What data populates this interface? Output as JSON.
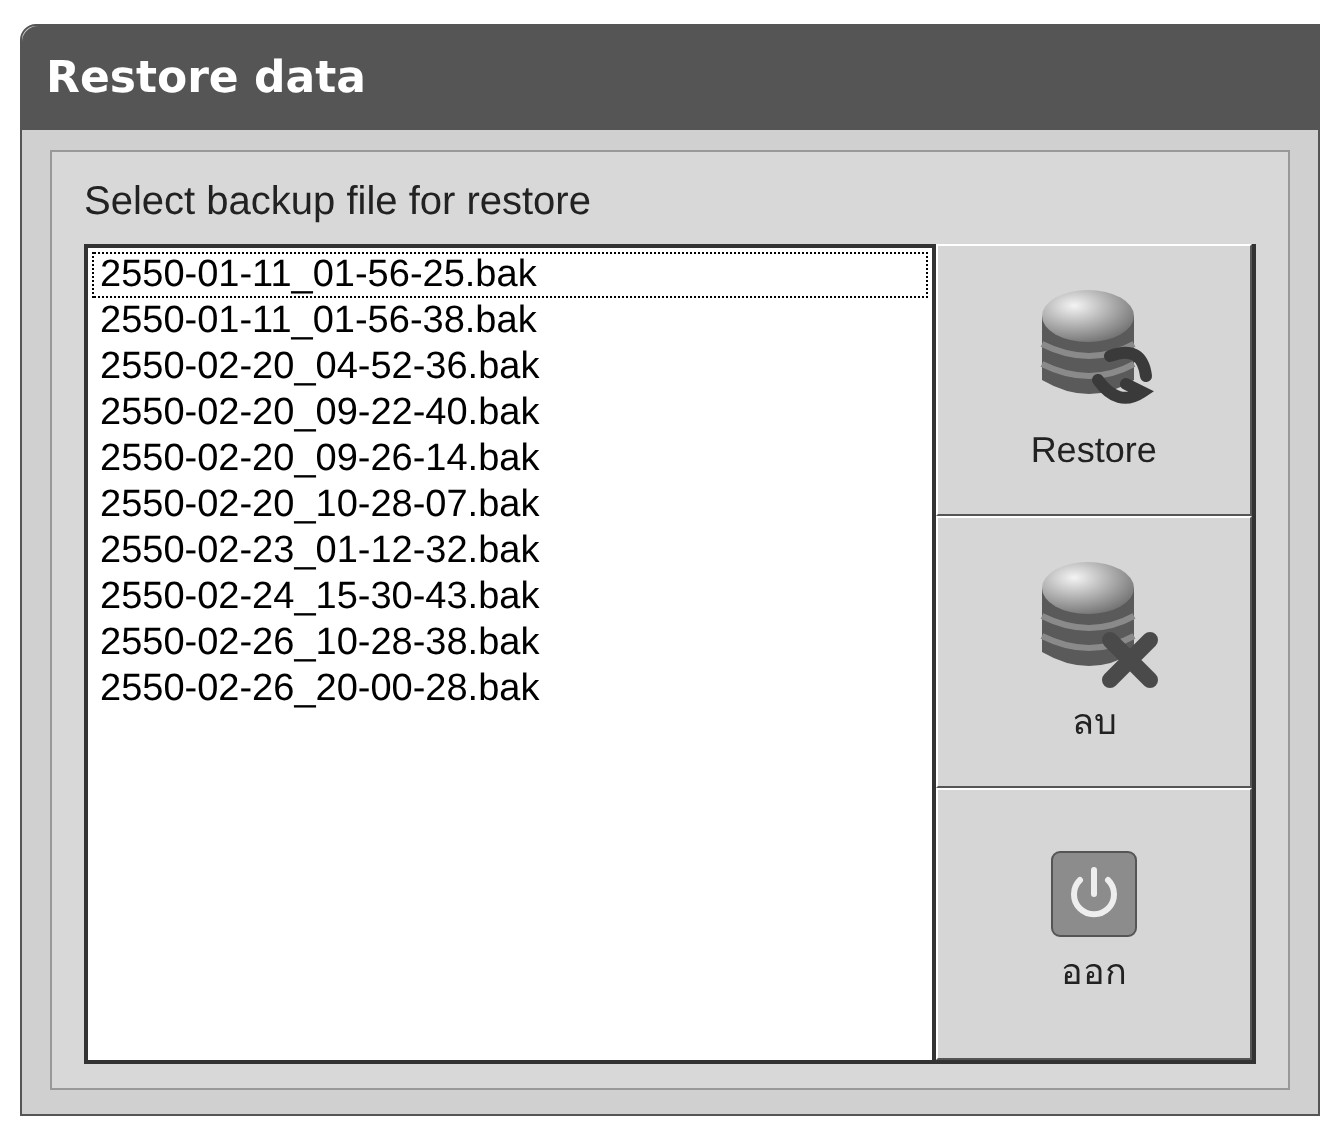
{
  "window": {
    "title": "Restore data"
  },
  "group": {
    "label": "Select backup file for restore"
  },
  "files": [
    {
      "name": "2550-01-11_01-56-25.bak",
      "selected": true
    },
    {
      "name": "2550-01-11_01-56-38.bak",
      "selected": false
    },
    {
      "name": "2550-02-20_04-52-36.bak",
      "selected": false
    },
    {
      "name": "2550-02-20_09-22-40.bak",
      "selected": false
    },
    {
      "name": "2550-02-20_09-26-14.bak",
      "selected": false
    },
    {
      "name": "2550-02-20_10-28-07.bak",
      "selected": false
    },
    {
      "name": "2550-02-23_01-12-32.bak",
      "selected": false
    },
    {
      "name": "2550-02-24_15-30-43.bak",
      "selected": false
    },
    {
      "name": "2550-02-26_10-28-38.bak",
      "selected": false
    },
    {
      "name": "2550-02-26_20-00-28.bak",
      "selected": false
    }
  ],
  "buttons": [
    {
      "label": "Restore",
      "kind": "restore"
    },
    {
      "label": "ลบ",
      "kind": "delete"
    },
    {
      "label": "ออก",
      "kind": "exit"
    }
  ]
}
